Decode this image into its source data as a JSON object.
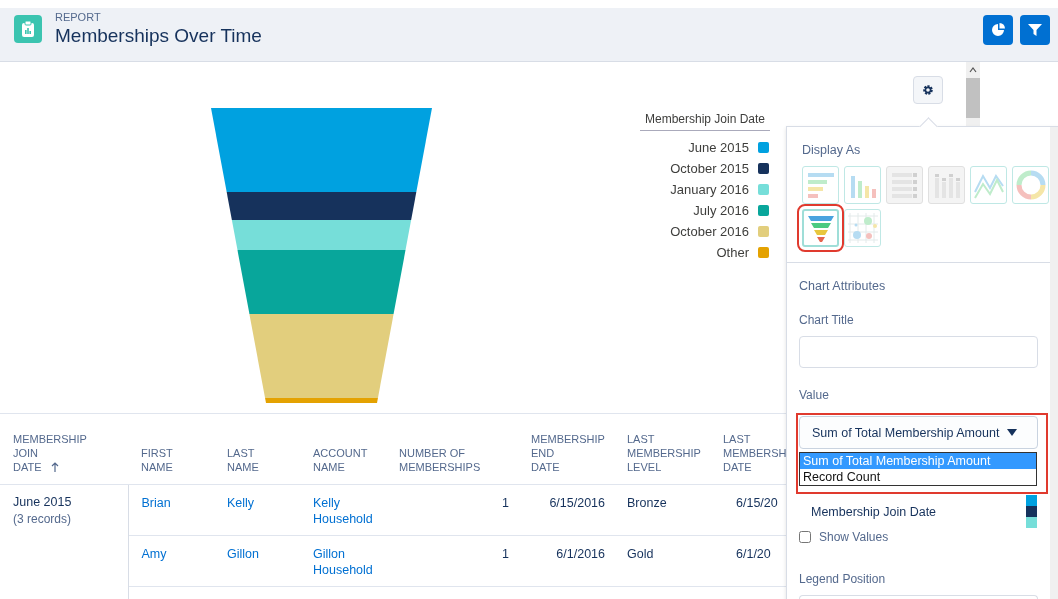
{
  "header": {
    "label": "REPORT",
    "title": "Memberships Over Time",
    "buttons": [
      {
        "kind": "chart"
      },
      {
        "kind": "filter"
      }
    ]
  },
  "chart": {
    "legend": {
      "title": "Membership Join Date",
      "items": [
        {
          "label": "June 2015",
          "color": "#00a1e0"
        },
        {
          "label": "October 2015",
          "color": "#16325c"
        },
        {
          "label": "January 2016",
          "color": "#76ded9"
        },
        {
          "label": "July 2016",
          "color": "#08a69b"
        },
        {
          "label": "October 2016",
          "color": "#e2ce7d"
        },
        {
          "label": "Other",
          "color": "#e4a201"
        }
      ]
    }
  },
  "table": {
    "columns": [
      {
        "label": "MEMBERSHIP\nJOIN\nDATE",
        "sorted": true
      },
      {
        "label": "FIRST\nNAME",
        "sorted": false
      },
      {
        "label": "LAST\nNAME",
        "sorted": false
      },
      {
        "label": "ACCOUNT\nNAME",
        "sorted": false
      },
      {
        "label": "NUMBER OF\nMEMBERSHIPS",
        "sorted": false
      },
      {
        "label": "MEMBERSHIP\nEND\nDATE",
        "sorted": false
      },
      {
        "label": "LAST\nMEMBERSHIP\nLEVEL",
        "sorted": false
      },
      {
        "label": "LAST\nMEMBERSH\nDATE",
        "sorted": false
      }
    ],
    "groups": [
      {
        "label": "June 2015",
        "count": "(3 records)",
        "rows": [
          [
            {
              "kind": "link",
              "text": "Brian"
            },
            {
              "kind": "link",
              "text": "Kelly"
            },
            {
              "kind": "link",
              "text": "Kelly Household"
            },
            {
              "kind": "number",
              "text": "1"
            },
            {
              "kind": "number",
              "text": "6/15/2016"
            },
            {
              "kind": "text",
              "text": "Bronze"
            },
            {
              "kind": "date",
              "text": "6/15/20"
            }
          ],
          [
            {
              "kind": "link",
              "text": "Amy"
            },
            {
              "kind": "link",
              "text": "Gillon"
            },
            {
              "kind": "link",
              "text": "Gillon Household"
            },
            {
              "kind": "number",
              "text": "1"
            },
            {
              "kind": "number",
              "text": "6/1/2016"
            },
            {
              "kind": "text",
              "text": "Gold"
            },
            {
              "kind": "date",
              "text": "6/1/20"
            }
          ]
        ]
      }
    ]
  },
  "chart_settings": {
    "display_as_label": "Display As",
    "chart_types": [
      {
        "kind": "bar",
        "selected": false,
        "disabled": false
      },
      {
        "kind": "column",
        "selected": false,
        "disabled": false
      },
      {
        "kind": "stacked-bar",
        "selected": false,
        "disabled": true
      },
      {
        "kind": "stacked-column",
        "selected": false,
        "disabled": true
      },
      {
        "kind": "line",
        "selected": false,
        "disabled": false
      },
      {
        "kind": "donut",
        "selected": false,
        "disabled": false
      },
      {
        "kind": "funnel",
        "selected": true,
        "disabled": false
      },
      {
        "kind": "scatter",
        "selected": false,
        "disabled": false
      }
    ],
    "attributes_label": "Chart Attributes",
    "title_label": "Chart Title",
    "value_label": "Value",
    "value": {
      "text": "Sum of Total Membership Amount",
      "expanded": true,
      "options": [
        {
          "label": "Sum of Total Membership Amount",
          "selected": true
        },
        {
          "label": "Record Count",
          "selected": false
        }
      ]
    },
    "grouping": {
      "label": "Membership Join Date",
      "swatches": [
        {
          "color": "#00a1e0"
        },
        {
          "color": "#16325c"
        },
        {
          "color": "#76ded9"
        }
      ]
    },
    "show_values": {
      "label": "Show Values",
      "checked": false
    },
    "legend_position_label": "Legend Position"
  }
}
